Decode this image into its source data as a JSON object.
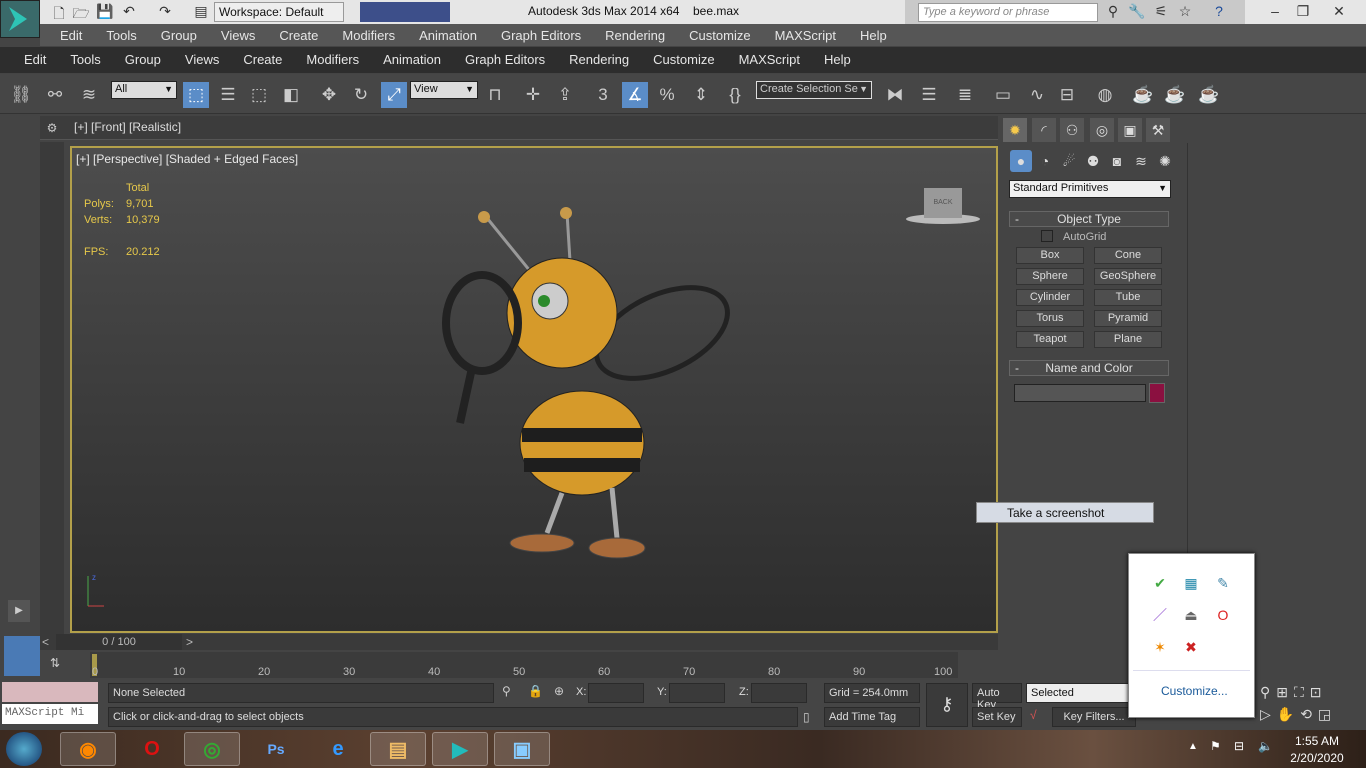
{
  "title_bar": {
    "app_title": "Autodesk 3ds Max  2014 x64",
    "file_name": "bee.max",
    "workspace": "Workspace: Default",
    "search_placeholder": "Type a keyword or phrase"
  },
  "menu_primary": [
    "Edit",
    "Tools",
    "Group",
    "Views",
    "Create",
    "Modifiers",
    "Animation",
    "Graph Editors",
    "Rendering",
    "Customize",
    "MAXScript",
    "Help"
  ],
  "menu_secondary": [
    "Edit",
    "Tools",
    "Group",
    "Views",
    "Create",
    "Modifiers",
    "Animation",
    "Graph Editors",
    "Rendering",
    "Customize",
    "MAXScript",
    "Help"
  ],
  "toolbar": {
    "selection_filter": "All",
    "reference_coord": "View",
    "named_selection": "Create Selection Se",
    "snap_label": "3"
  },
  "viewports": {
    "front_label": "[+] [Front] [Realistic]",
    "perspective_label": "[+] [Perspective] [Shaded + Edged Faces]",
    "stats": {
      "header": "Total",
      "polys_label": "Polys:",
      "polys": "9,701",
      "verts_label": "Verts:",
      "verts": "10,379",
      "fps_label": "FPS:",
      "fps": "20.212"
    },
    "viewcube_label": "BACK"
  },
  "command_panel": {
    "category": "Standard Primitives",
    "object_type_title": "Object Type",
    "autogrid": "AutoGrid",
    "autogrid_checked": false,
    "buttons": [
      "Box",
      "Cone",
      "Sphere",
      "GeoSphere",
      "Cylinder",
      "Tube",
      "Torus",
      "Pyramid",
      "Teapot",
      "Plane"
    ],
    "name_color_title": "Name and Color",
    "object_color": "#8b1040"
  },
  "tooltip": "Take a screenshot",
  "tray_popup": {
    "customize": "Customize..."
  },
  "timeline": {
    "frame": "0 / 100",
    "ticks": [
      "0",
      "10",
      "20",
      "30",
      "40",
      "50",
      "60",
      "70",
      "80",
      "90",
      "100"
    ]
  },
  "status": {
    "selection": "None Selected",
    "prompt": "Click or click-and-drag to select objects",
    "x_label": "X:",
    "y_label": "Y:",
    "z_label": "Z:",
    "grid": "Grid = 254.0mm",
    "add_time_tag": "Add Time Tag",
    "auto_key": "Auto Key",
    "set_key": "Set Key",
    "key_mode": "Selected",
    "key_filters": "Key Filters...",
    "maxscript": "MAXScript Mi"
  },
  "taskbar": {
    "time": "1:55 AM",
    "date": "2/20/2020",
    "apps": [
      "Firefox",
      "Opera",
      "Chrome",
      "Photoshop",
      "Internet Explorer",
      "File Explorer",
      "3ds Max",
      "Photos"
    ]
  }
}
